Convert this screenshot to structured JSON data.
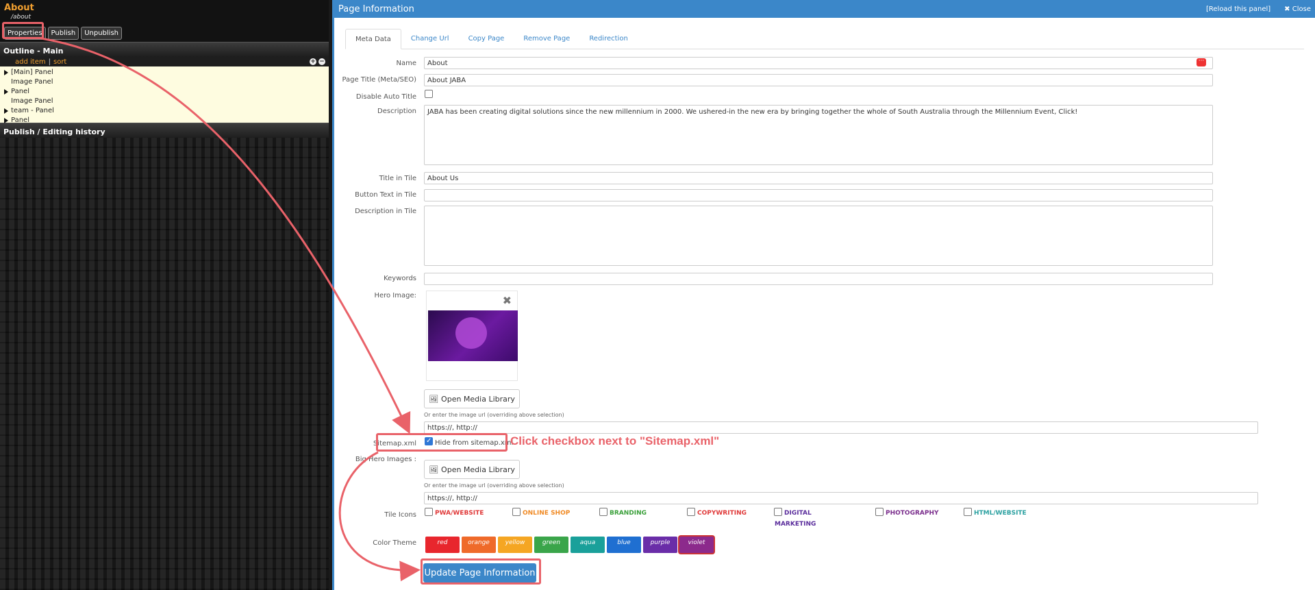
{
  "left": {
    "page_name": "About",
    "page_path": "/about",
    "buttons": [
      "Properties",
      "Publish",
      "Unpublish"
    ],
    "outline_title": "Outline - Main",
    "outline_actions": {
      "add": "add item",
      "sep": "|",
      "sort": "sort"
    },
    "outline_items": [
      {
        "label": "[Main] Panel",
        "expandable": true
      },
      {
        "label": "Image Panel",
        "expandable": false
      },
      {
        "label": "Panel",
        "expandable": true
      },
      {
        "label": "Image Panel",
        "expandable": false
      },
      {
        "label": "team - Panel",
        "expandable": true
      },
      {
        "label": "Panel",
        "expandable": true
      }
    ],
    "history_title": "Publish / Editing history"
  },
  "header": {
    "title": "Page Information",
    "reload": "[Reload this panel]",
    "close": "Close"
  },
  "tabs": [
    "Meta Data",
    "Change Url",
    "Copy Page",
    "Remove Page",
    "Redirection"
  ],
  "form": {
    "name_label": "Name",
    "name_value": "About",
    "page_title_label": "Page Title (Meta/SEO)",
    "page_title_value": "About JABA",
    "disable_auto_title_label": "Disable Auto Title",
    "description_label": "Description",
    "description_value": "JABA has been creating digital solutions since the new millennium in 2000. We ushered-in the new era by bringing together the whole of South Australia through the Millennium Event, Click!",
    "title_in_tile_label": "Title in Tile",
    "title_in_tile_value": "About Us",
    "button_text_label": "Button Text in Tile",
    "button_text_value": "",
    "desc_in_tile_label": "Description in Tile",
    "desc_in_tile_value": "",
    "keywords_label": "Keywords",
    "keywords_value": "",
    "hero_label": "Hero Image:",
    "open_media": "Open Media Library",
    "image_url_hint": "Or enter the image url (overriding above selection)",
    "image_url_placeholder": "https://, http://",
    "sitemap_label": "Sitemap.xml",
    "hide_sitemap_label": "Hide from sitemap.xml",
    "big_hero_label": "Big Hero Images :",
    "tile_icons_label": "Tile Icons",
    "tile_icons": [
      {
        "label": "PWA/WEBSITE",
        "color": "#e03a3a"
      },
      {
        "label": "ONLINE SHOP",
        "color": "#f08a24"
      },
      {
        "label": "BRANDING",
        "color": "#3aa03a"
      },
      {
        "label": "COPYWRITING",
        "color": "#e03a3a"
      },
      {
        "label": "DIGITAL",
        "label2": "MARKETING",
        "color": "#5a2d9c"
      },
      {
        "label": "PHOTOGRAPHY",
        "color": "#7a2d8c"
      },
      {
        "label": "HTML/WEBSITE",
        "color": "#2aa0a0"
      }
    ],
    "color_theme_label": "Color Theme",
    "color_themes": [
      {
        "label": "red",
        "color": "#e8262d"
      },
      {
        "label": "orange",
        "color": "#ef6a2a"
      },
      {
        "label": "yellow",
        "color": "#f5a623"
      },
      {
        "label": "green",
        "color": "#3aa54a"
      },
      {
        "label": "aqua",
        "color": "#1aa09a"
      },
      {
        "label": "blue",
        "color": "#1f6fd1"
      },
      {
        "label": "purple",
        "color": "#6a2da8"
      },
      {
        "label": "violet",
        "color": "#8c2a8c"
      }
    ],
    "update_button": "Update Page Information"
  },
  "annotation": {
    "text": "Click checkbox next to \"Sitemap.xml\"",
    "color": "#e96269"
  }
}
